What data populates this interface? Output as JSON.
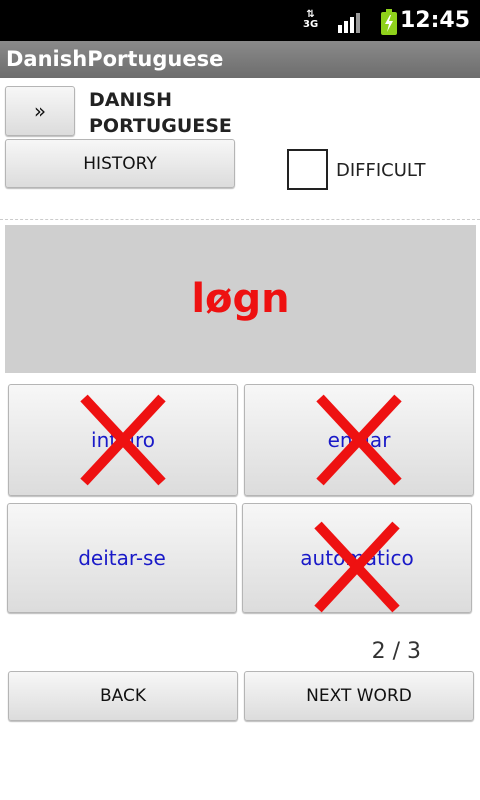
{
  "status_bar": {
    "network": "3G",
    "time": "12:45"
  },
  "app": {
    "title": "DanishPortuguese"
  },
  "toolbar": {
    "swap_label": "»",
    "language_from": "DANISH",
    "language_to": "PORTUGUESE",
    "history_label": "HISTORY",
    "difficult_label": "DIFFICULT",
    "difficult_checked": false
  },
  "quiz": {
    "word": "løgn",
    "answers": [
      {
        "label": "inteiro",
        "marked_wrong": true
      },
      {
        "label": "enviar",
        "marked_wrong": true
      },
      {
        "label": "deitar-se",
        "marked_wrong": false
      },
      {
        "label": "automático",
        "marked_wrong": true
      }
    ],
    "progress": "2 / 3"
  },
  "nav": {
    "back_label": "BACK",
    "next_label": "NEXT WORD"
  },
  "colors": {
    "word": "#ee1111",
    "answer_text": "#1a1ac8",
    "wrong_mark": "#ee1111",
    "panel": "#cfcfcf"
  }
}
